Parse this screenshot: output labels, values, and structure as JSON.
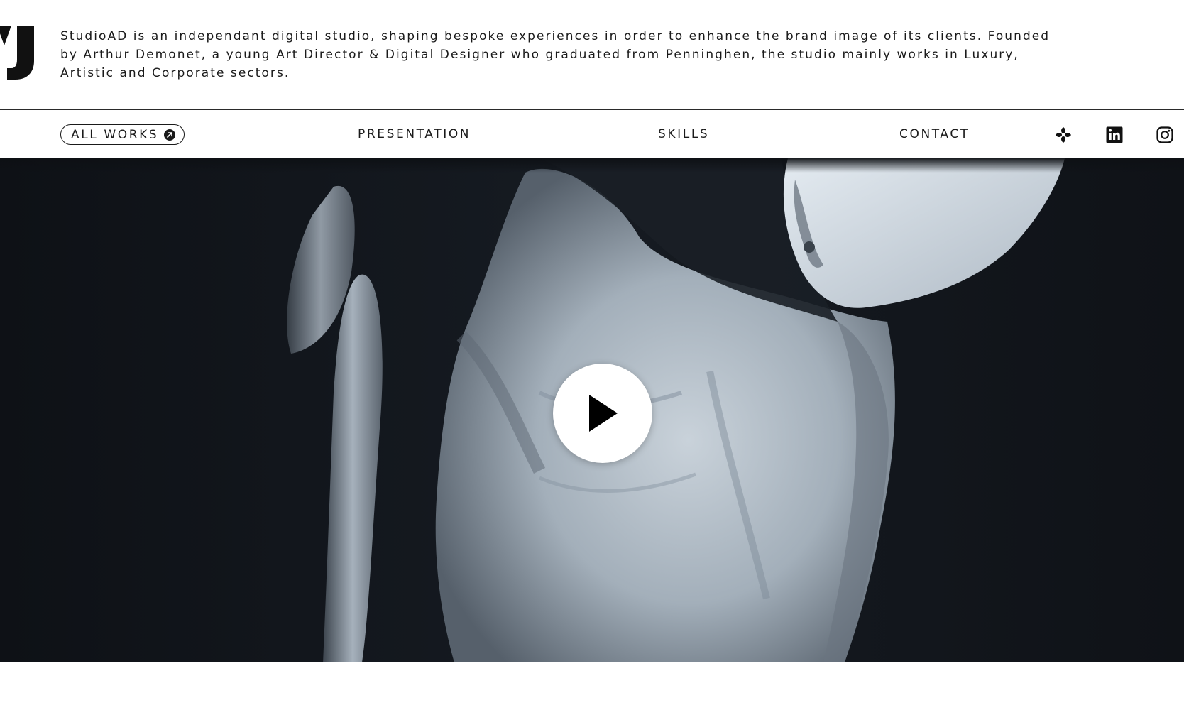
{
  "intro": {
    "text": "StudioAD is an independant digital studio, shaping bespoke experiences in order to enhance the brand image of its clients. Founded by Arthur Demonet, a young Art Director & Digital Designer who graduated from Penninghen, the studio mainly works in Luxury, Artistic and Corporate sectors."
  },
  "nav": {
    "all_works": "ALL WORKS",
    "presentation": "PRESENTATION",
    "skills": "SKILLS",
    "contact": "CONTACT"
  },
  "social": [
    {
      "icon": "dribbble-swirl-icon"
    },
    {
      "icon": "linkedin-icon"
    },
    {
      "icon": "instagram-icon"
    }
  ],
  "hero": {
    "media": "video",
    "play_icon": "play-icon"
  },
  "colors": {
    "text": "#1a1a1a",
    "background": "#ffffff",
    "hero_dark": "#12151b",
    "sculpture_light": "#c9d3dc"
  }
}
